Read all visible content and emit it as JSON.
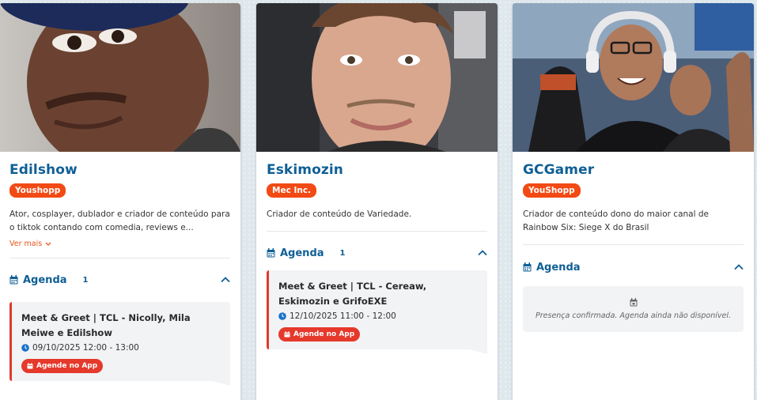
{
  "cards": [
    {
      "name": "Edilshow",
      "badge": "Youshopp",
      "description": "Ator, cosplayer, dublador e criador de conteúdo para o tiktok contando com comedia, reviews e...",
      "ver_mais": "Ver mais",
      "agenda_label": "Agenda",
      "agenda_count": "1",
      "event": {
        "title": "Meet & Greet | TCL - Nicolly, Mila Meiwe e Edilshow",
        "time": "09/10/2025 12:00 - 13:00",
        "button": "Agende no App"
      }
    },
    {
      "name": "Eskimozin",
      "badge": "Mec Inc.",
      "description": "Criador de conteúdo de Variedade.",
      "agenda_label": "Agenda",
      "agenda_count": "1",
      "event": {
        "title": "Meet & Greet | TCL - Cereaw, Eskimozin e GrifoEXE",
        "time": "12/10/2025 11:00 - 12:00",
        "button": "Agende no App"
      }
    },
    {
      "name": "GCGamer",
      "badge": "YouShopp",
      "description": "Criador de conteúdo dono do maior canal de Rainbow Six: Siege X do Brasil",
      "agenda_label": "Agenda",
      "empty_text": "Presença confirmada. Agenda ainda não disponível."
    }
  ],
  "colors": {
    "brand_blue": "#0f5f96",
    "badge_orange": "#f24a14",
    "event_red": "#e5392c"
  },
  "icons": [
    "calendar-icon",
    "clock-icon",
    "chevron-up-icon",
    "chevron-down-icon"
  ]
}
